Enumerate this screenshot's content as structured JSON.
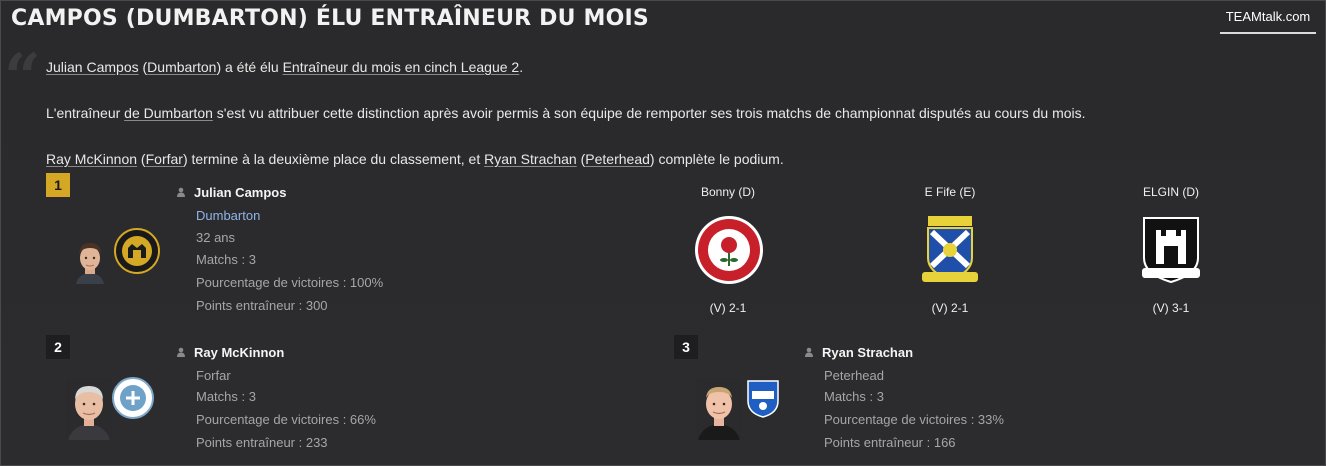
{
  "article": {
    "headline": "CAMPOS (DUMBARTON) ÉLU ENTRAÎNEUR DU MOIS",
    "source": "TEAMtalk.com",
    "p1": {
      "manager": "Julian Campos",
      "open": " (",
      "club": "Dumbarton",
      "mid": ") a été élu ",
      "award": "Entraîneur du mois en cinch League 2",
      "end": "."
    },
    "p2": {
      "start": "L'entraîneur ",
      "club": "de Dumbarton",
      "end": " s'est vu attribuer cette distinction après avoir permis à son équipe de remporter ses trois matchs de championnat disputés au cours du mois."
    },
    "p3": {
      "m2": "Ray McKinnon",
      "o1": " (",
      "c2": "Forfar",
      "mid": ") termine à la deuxième place du classement, et ",
      "m3": "Ryan Strachan",
      "o2": " (",
      "c3": "Peterhead",
      "end": ") complète le podium."
    }
  },
  "podium": [
    {
      "rank": "1",
      "name": "Julian Campos",
      "club": "Dumbarton",
      "age": "32 ans",
      "matches": "Matchs : 3",
      "win_pct": "Pourcentage de victoires : 100%",
      "points": "Points entraîneur : 300"
    },
    {
      "rank": "2",
      "name": "Ray McKinnon",
      "club": "Forfar",
      "matches": "Matchs : 3",
      "win_pct": "Pourcentage de victoires : 66%",
      "points": "Points entraîneur : 233"
    },
    {
      "rank": "3",
      "name": "Ryan Strachan",
      "club": "Peterhead",
      "matches": "Matchs : 3",
      "win_pct": "Pourcentage de victoires : 33%",
      "points": "Points entraîneur : 166"
    }
  ],
  "results": [
    {
      "opponent": "Bonny (D)",
      "score": "(V) 2-1",
      "crest": "bonnyrigg-rose-crest"
    },
    {
      "opponent": "E Fife (E)",
      "score": "(V) 2-1",
      "crest": "east-fife-crest"
    },
    {
      "opponent": "ELGIN (D)",
      "score": "(V) 3-1",
      "crest": "elgin-city-crest"
    }
  ],
  "colors": {
    "background": "#2b2b2d",
    "gold_rank": "#d4a824",
    "club_link": "#8fb4e6",
    "muted_text": "#a6a6a6"
  }
}
